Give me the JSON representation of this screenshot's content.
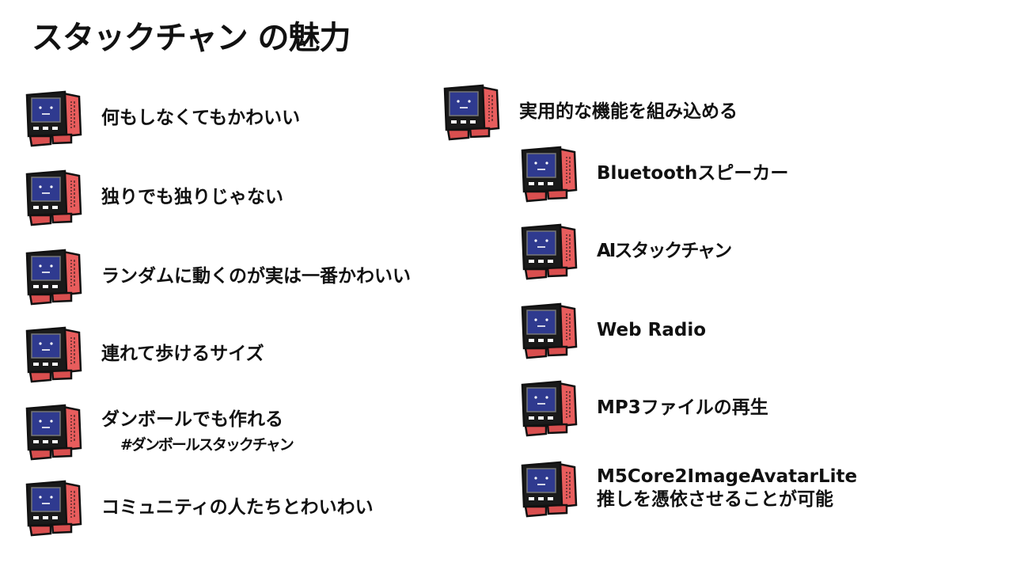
{
  "slide": {
    "title": "スタックチャン の魅力"
  },
  "left_items": [
    {
      "label": "何もしなくてもかわいい"
    },
    {
      "label": "独りでも独りじゃない"
    },
    {
      "label": "ランダムに動くのが実は一番かわいい"
    },
    {
      "label": "連れて歩けるサイズ"
    },
    {
      "label": "ダンボールでも作れる",
      "sublabel": "#ダンボールスタックチャン"
    },
    {
      "label": "コミュニティの人たちとわいわい"
    }
  ],
  "right_header": {
    "label": "実用的な機能を組み込める"
  },
  "right_items": [
    {
      "label": "Bluetoothスピーカー"
    },
    {
      "label": "AIスタックチャン"
    },
    {
      "label": "Web Radio"
    },
    {
      "label": "MP3ファイルの再生"
    },
    {
      "label": "M5Core2ImageAvatarLite",
      "sublabel": "推しを憑依させることが可能"
    }
  ],
  "icon": {
    "name": "stackchan-robot-icon",
    "body_color": "#1a1a1a",
    "screen_color": "#2f3a8f",
    "side_color": "#e85d5d",
    "foot_color": "#d94f4f"
  }
}
